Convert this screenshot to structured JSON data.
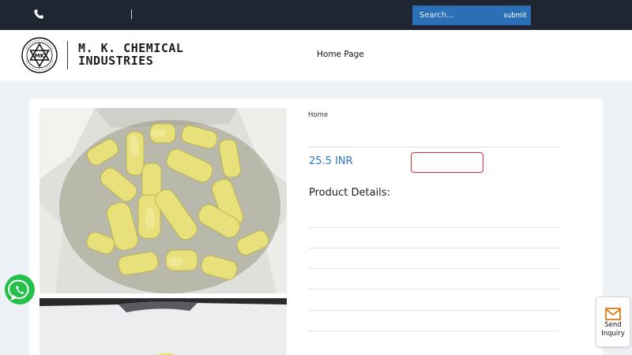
{
  "topbar": {
    "search_placeholder": "Search...",
    "submit_label": "submit"
  },
  "header": {
    "logo_text": "SEAL OF PURITY · MK",
    "brand_line1": "M. K. CHEMICAL",
    "brand_line2": "INDUSTRIES",
    "nav_home": "Home Page"
  },
  "product": {
    "breadcrumb": "Home",
    "price": "25.5 INR",
    "details_heading": "Product Details:"
  },
  "widgets": {
    "send_inquiry_line1": "Send",
    "send_inquiry_line2": "Inquiry"
  },
  "colors": {
    "topbar_bg": "#1f2631",
    "search_bg": "#2b6fb7",
    "price": "#2b78c6",
    "inquiry_border": "#c8323a",
    "whatsapp": "#25c04a",
    "mail_icon": "#e07b1a"
  }
}
